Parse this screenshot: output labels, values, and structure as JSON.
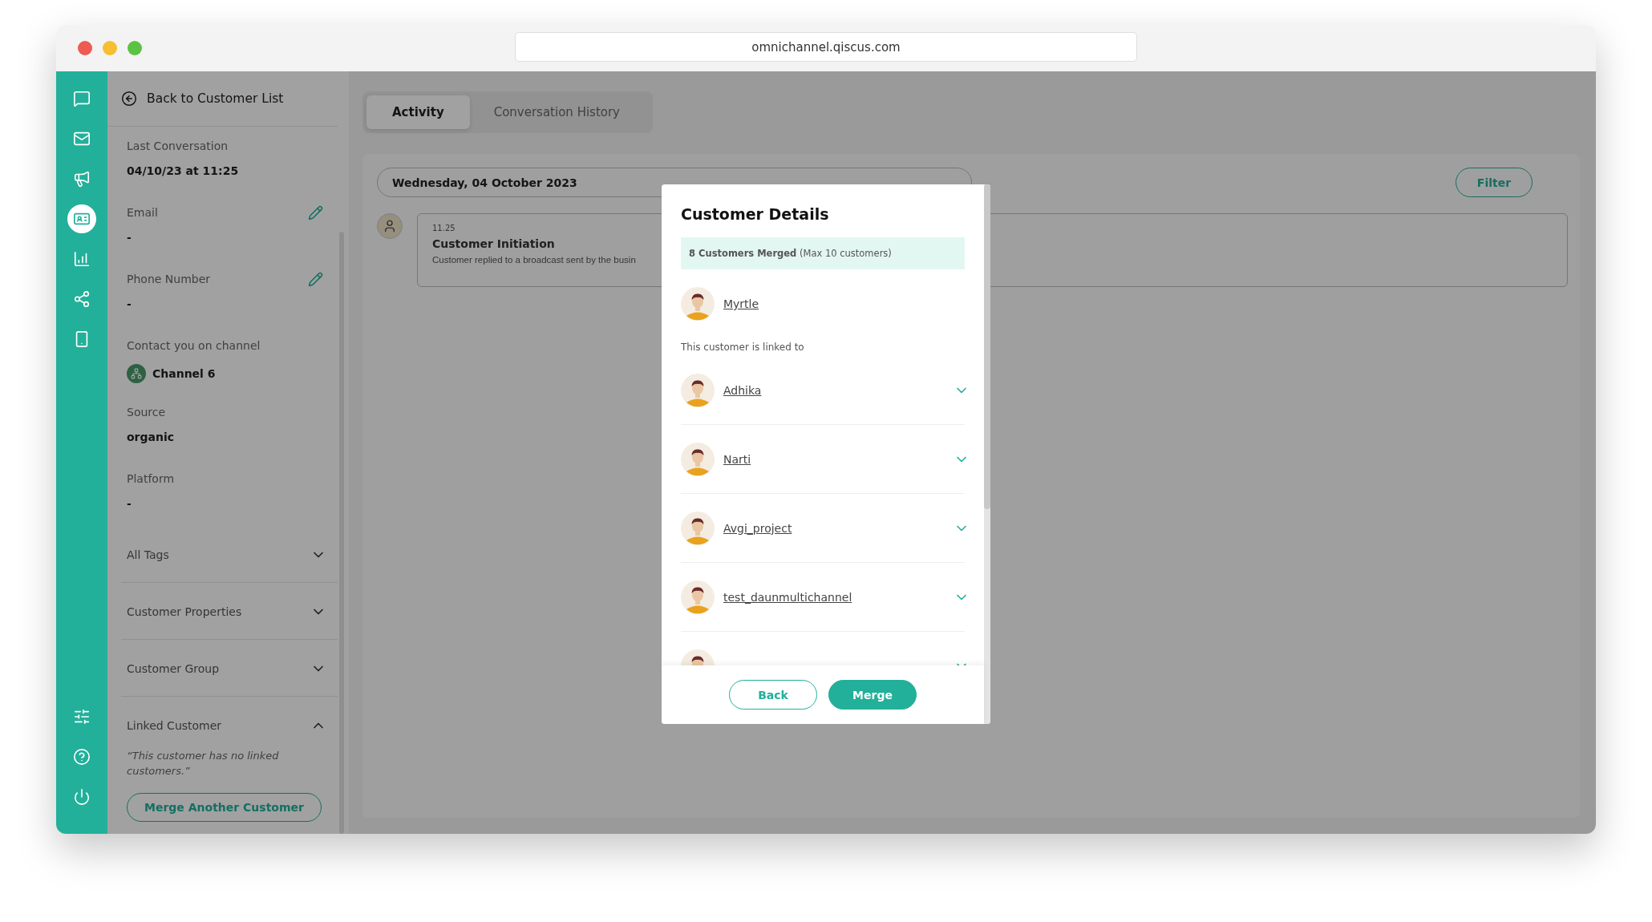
{
  "browser": {
    "url": "omnichannel.qiscus.com"
  },
  "rail": {
    "top": [
      {
        "selected": false
      },
      {
        "selected": false
      },
      {
        "selected": false
      },
      {
        "selected": true
      },
      {
        "selected": false
      },
      {
        "selected": false
      },
      {
        "selected": false
      }
    ]
  },
  "panel": {
    "back": "Back to Customer List",
    "fields": [
      {
        "kind": "text",
        "label": "Last Conversation",
        "value": "04/10/23 at 11:25",
        "editable": false
      },
      {
        "kind": "text",
        "label": "Email",
        "value": "-",
        "editable": true
      },
      {
        "kind": "text",
        "label": "Phone Number",
        "value": "-",
        "editable": true
      },
      {
        "kind": "channel",
        "label": "Contact you on channel",
        "value": "Channel 6",
        "editable": false
      },
      {
        "kind": "text",
        "label": "Source",
        "value": "organic",
        "editable": false
      },
      {
        "kind": "text",
        "label": "Platform",
        "value": "-",
        "editable": false
      }
    ],
    "sections": [
      {
        "label": "All Tags",
        "expanded": false
      },
      {
        "label": "Customer Properties",
        "expanded": false
      },
      {
        "label": "Customer Group",
        "expanded": false
      },
      {
        "label": "Linked Customer",
        "expanded": true,
        "note": "“This customer has no linked customers.”",
        "button": "Merge Another Customer"
      }
    ]
  },
  "tabs": [
    {
      "label": "Activity",
      "selected": true
    },
    {
      "label": "Conversation History",
      "selected": false
    }
  ],
  "activity": {
    "date": "Wednesday, 04 October 2023",
    "filter": "Filter",
    "event": {
      "time": "11.25",
      "title": "Customer Initiation",
      "text": "Customer replied to a broadcast sent by the busin"
    }
  },
  "modal": {
    "title": "Customer Details",
    "banner": "**8 Customers Merged** (Max 10 customers)",
    "primary": "Myrtle",
    "linked_label": "This customer is linked to",
    "linked": [
      {
        "name": "Adhika",
        "expanded": false
      },
      {
        "name": "Narti",
        "expanded": false
      },
      {
        "name": "Avgi_project",
        "expanded": false
      },
      {
        "name": "test_daunmultichannel",
        "expanded": false
      },
      {
        "expanded": false
      }
    ],
    "buttons": [
      {
        "label": "Back",
        "kind": "secondary"
      },
      {
        "label": "Merge",
        "kind": "primary"
      }
    ]
  }
}
